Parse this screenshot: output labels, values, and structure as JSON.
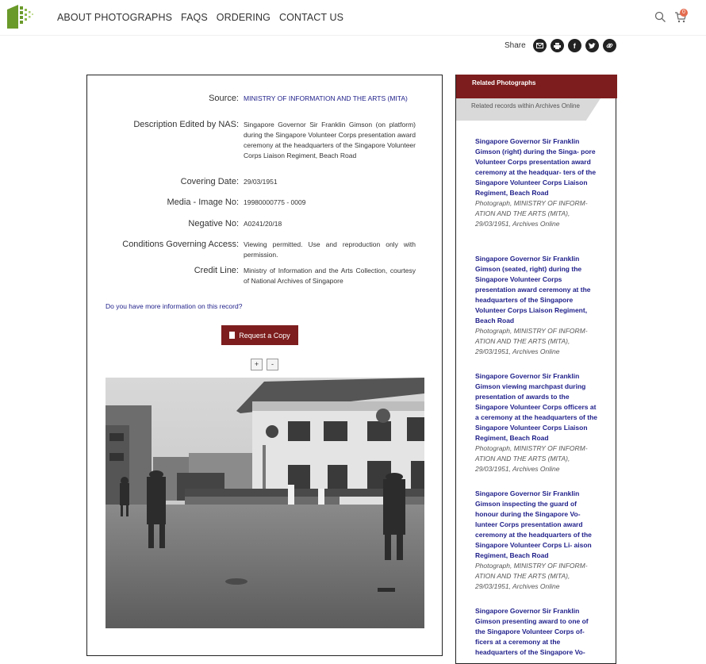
{
  "nav": {
    "items": [
      "ABOUT PHOTOGRAPHS",
      "FAQS",
      "ORDERING",
      "CONTACT US"
    ],
    "cart_count": "0"
  },
  "share": {
    "label": "Share"
  },
  "record": {
    "fields": [
      {
        "label": "Source:",
        "value": "MINISTRY OF INFORMATION AND THE ARTS (MITA)"
      },
      {
        "label": "Description Edited by NAS:",
        "value": "Singapore Governor Sir Franklin Gimson (on platform) during the Singapore Volunteer Corps presentation award ceremony at the headquarters of the Singapore Volunteer Corps Liaison Regiment, Beach Road"
      },
      {
        "label": "Covering Date:",
        "value": "29/03/1951"
      },
      {
        "label": "Media - Image No:",
        "value": "19980000775 - 0009"
      },
      {
        "label": "Negative No:",
        "value": "A0241/20/18"
      },
      {
        "label": "Conditions Governing Access:",
        "value": "Viewing permitted. Use and reproduction only with permission."
      },
      {
        "label": "Credit Line:",
        "value": "Ministry of Information and the Arts Collection, courtesy of National Archives of Singapore"
      }
    ],
    "more_info": "Do you have more information on this record?",
    "request_label": "Request a Copy",
    "zoom_in": "+",
    "zoom_out": "-"
  },
  "sidebar": {
    "header": "Related Photographs",
    "tab": "Related records within Archives Online",
    "items": [
      {
        "title": "Singapore Governor Sir Franklin Gimson (right) during the Singa- pore Volunteer Corps presentation award ceremony at the headquar- ters of the Singapore Volunteer Corps Liaison Regiment, Beach Road",
        "meta": "Photograph, MINISTRY OF INFORM- ATION AND THE ARTS (MITA), 29/03/1951, Archives Online"
      },
      {
        "title": "Singapore Governor Sir Franklin Gimson (seated, right) during the Singapore Volunteer Corps presentation award ceremony at the headquarters of the Singapore Volunteer Corps Liaison Regiment, Beach Road",
        "meta": "Photograph, MINISTRY OF INFORM- ATION AND THE ARTS (MITA), 29/03/1951, Archives Online"
      },
      {
        "title": "Singapore Governor Sir Franklin Gimson viewing marchpast during presentation of awards to the Singapore Volunteer Corps officers at a ceremony at the headquarters of the Singapore Volunteer Corps Liaison Regiment, Beach Road",
        "meta": "Photograph, MINISTRY OF INFORM- ATION AND THE ARTS (MITA), 29/03/1951, Archives Online"
      },
      {
        "title": "Singapore Governor Sir Franklin Gimson inspecting the guard of honour during the Singapore Vo- lunteer Corps presentation award ceremony at the headquarters of the Singapore Volunteer Corps Li- aison Regiment, Beach Road",
        "meta": "Photograph, MINISTRY OF INFORM- ATION AND THE ARTS (MITA), 29/03/1951, Archives Online"
      },
      {
        "title": "Singapore Governor Sir Franklin Gimson presenting award to one of the Singapore Volunteer Corps of- ficers at a ceremony at the headquarters of the Singapore Vo-",
        "meta": ""
      }
    ]
  },
  "colors": {
    "accent": "#7d1d1d",
    "link": "#1e1e8a",
    "logo_green": "#6a9a2a"
  }
}
